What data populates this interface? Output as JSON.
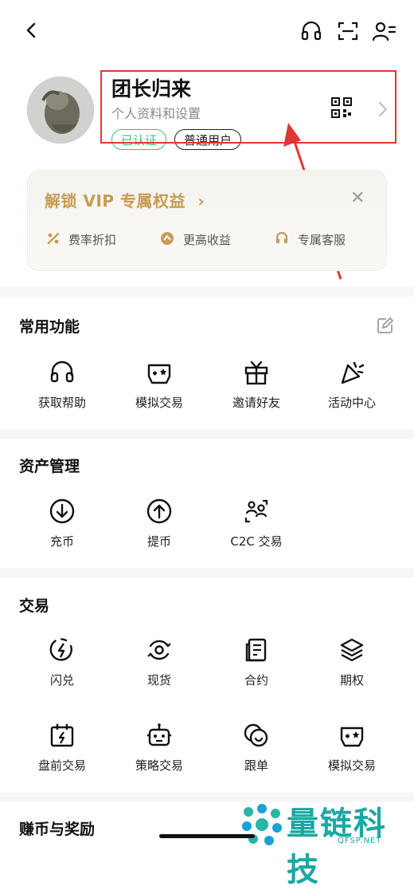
{
  "profile": {
    "username": "团长归来",
    "subtitle": "个人资料和设置",
    "badge_verified": "已认证",
    "badge_user": "普通用户"
  },
  "vip": {
    "title": "解锁 VIP 专属权益",
    "benefits": [
      "费率折扣",
      "更高收益",
      "专属客服"
    ]
  },
  "sections": {
    "common": {
      "title": "常用功能",
      "items": [
        "获取帮助",
        "模拟交易",
        "邀请好友",
        "活动中心"
      ]
    },
    "assets": {
      "title": "资产管理",
      "items": [
        "充币",
        "提币",
        "C2C 交易"
      ]
    },
    "trade": {
      "title": "交易",
      "items": [
        "闪兑",
        "现货",
        "合约",
        "期权",
        "盘前交易",
        "策略交易",
        "跟单",
        "模拟交易"
      ]
    },
    "earn": {
      "title": "赚币与奖励"
    }
  },
  "watermark": {
    "text": "量链科技",
    "sub": "QFSP.NET"
  },
  "colors": {
    "accent_gold": "#c89a52",
    "verified_green": "#3cc26c",
    "highlight_red": "#e03636",
    "watermark_teal": "#1aa8a2"
  }
}
